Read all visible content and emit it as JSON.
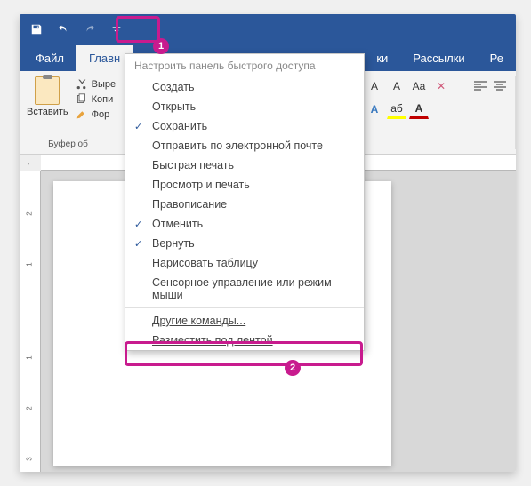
{
  "qat": {
    "customize_tooltip": "Настроить панель быстрого доступа"
  },
  "tabs": {
    "file": "Файл",
    "home": "Главн",
    "partial1": "ки",
    "mailings": "Рассылки",
    "review": "Ре"
  },
  "clipboard": {
    "paste": "Вставить",
    "cut": "Выре",
    "copy": "Копи",
    "format_painter": "Фор",
    "group_label": "Буфер об"
  },
  "font": {
    "bigA": "A",
    "smallA": "A",
    "caseAa": "Aa",
    "clear": "✕",
    "highlight": "aб",
    "fontcolor": "A"
  },
  "dropdown": {
    "title": "Настроить панель быстрого доступа",
    "items": [
      {
        "label": "Создать",
        "checked": false
      },
      {
        "label": "Открыть",
        "checked": false
      },
      {
        "label": "Сохранить",
        "checked": true
      },
      {
        "label": "Отправить по электронной почте",
        "checked": false
      },
      {
        "label": "Быстрая печать",
        "checked": false
      },
      {
        "label": "Просмотр и печать",
        "checked": false
      },
      {
        "label": "Правописание",
        "checked": false
      },
      {
        "label": "Отменить",
        "checked": true
      },
      {
        "label": "Вернуть",
        "checked": true
      },
      {
        "label": "Нарисовать таблицу",
        "checked": false
      },
      {
        "label": "Сенсорное управление или режим мыши",
        "checked": false
      }
    ],
    "more_commands": "Другие команды...",
    "below_ribbon": "Разместить под лентой"
  },
  "ruler_v": [
    "2",
    "1",
    "",
    "1",
    "2",
    "3"
  ],
  "annotations": {
    "1": "1",
    "2": "2"
  }
}
